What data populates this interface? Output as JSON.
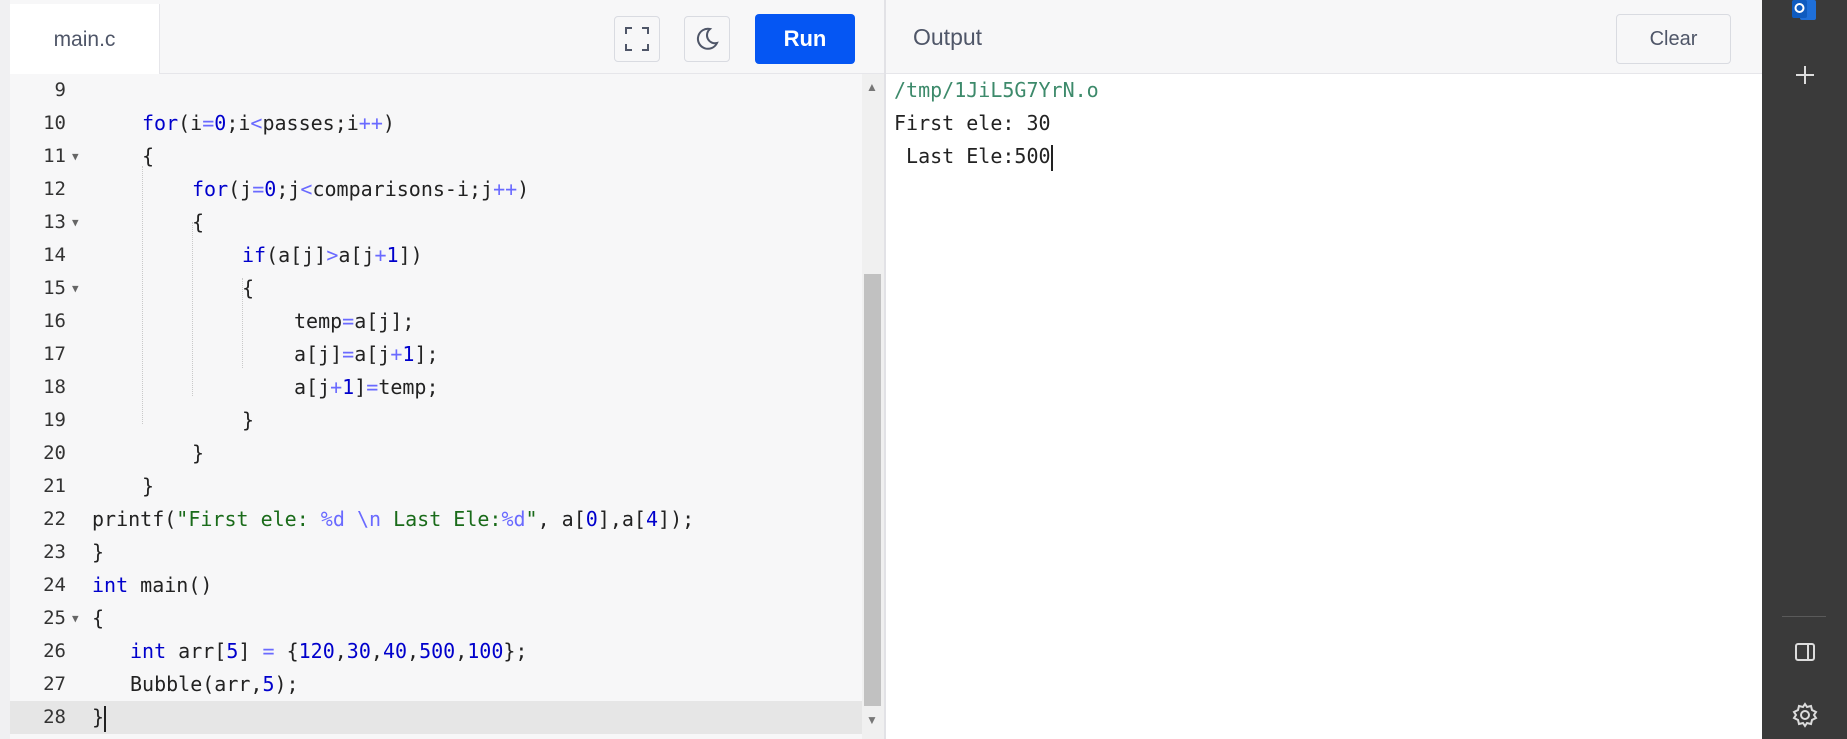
{
  "editor": {
    "file_tab": "main.c",
    "run_label": "Run",
    "lines": [
      {
        "n": "9"
      },
      {
        "n": "10"
      },
      {
        "n": "11"
      },
      {
        "n": "12"
      },
      {
        "n": "13"
      },
      {
        "n": "14"
      },
      {
        "n": "15"
      },
      {
        "n": "16"
      },
      {
        "n": "17"
      },
      {
        "n": "18"
      },
      {
        "n": "19"
      },
      {
        "n": "20"
      },
      {
        "n": "21"
      },
      {
        "n": "22"
      },
      {
        "n": "23"
      },
      {
        "n": "24"
      },
      {
        "n": "25"
      },
      {
        "n": "26"
      },
      {
        "n": "27"
      },
      {
        "n": "28"
      }
    ],
    "tokens": {
      "for": "for",
      "if": "if",
      "int": "int",
      "l10_a": "(i",
      "eq": "=",
      "zero": "0",
      "semi_i": ";i",
      "lt": "<",
      "passes": "passes;i",
      "inc": "++",
      "rparen": ")",
      "lbrace": "{",
      "rbrace": "}",
      "l12_a": "(j",
      "semi_j": ";j",
      "comparisons": "comparisons-i;j",
      "l14_a": "(a[j]",
      "gt": ">",
      "l14_b": "a[j",
      "plus": "+",
      "one": "1",
      "l14_c": "])",
      "l16": "temp",
      "l16_b": "a[j];",
      "l17_a": "a[j]",
      "l17_b": "a[j",
      "l17_c": "];",
      "l18_a": "a[j",
      "l18_b": "]",
      "l18_c": "temp;",
      "printf": "printf(",
      "str1": "\"First ele: ",
      "fmt_d": "%d",
      "esc_n": "\\n",
      "str2": " Last Ele:",
      "str_end": "\"",
      "l22_b": ", a[",
      "four": "4",
      "l22_c": "],a[",
      "l22_d": "]);",
      "main": " main()",
      "arr": " arr[",
      "five": "5",
      "arr_b": "] ",
      "arr_c": " {",
      "n120": "120",
      "comma": ",",
      "n30": "30",
      "n40": "40",
      "n500": "500",
      "n100": "100",
      "arr_end": "};",
      "bubble": "Bubble(arr,",
      "bubble_end": ");"
    }
  },
  "output": {
    "title": "Output",
    "clear_label": "Clear",
    "lines": [
      "/tmp/1JiL5G7YrN.o",
      "First ele: 30",
      " Last Ele:500"
    ]
  },
  "icons": {
    "fullscreen": "fullscreen-icon",
    "theme": "moon-icon",
    "outlook": "outlook-icon",
    "add": "plus-icon",
    "sidebar": "sidebar-panel-icon",
    "settings": "gear-icon"
  }
}
